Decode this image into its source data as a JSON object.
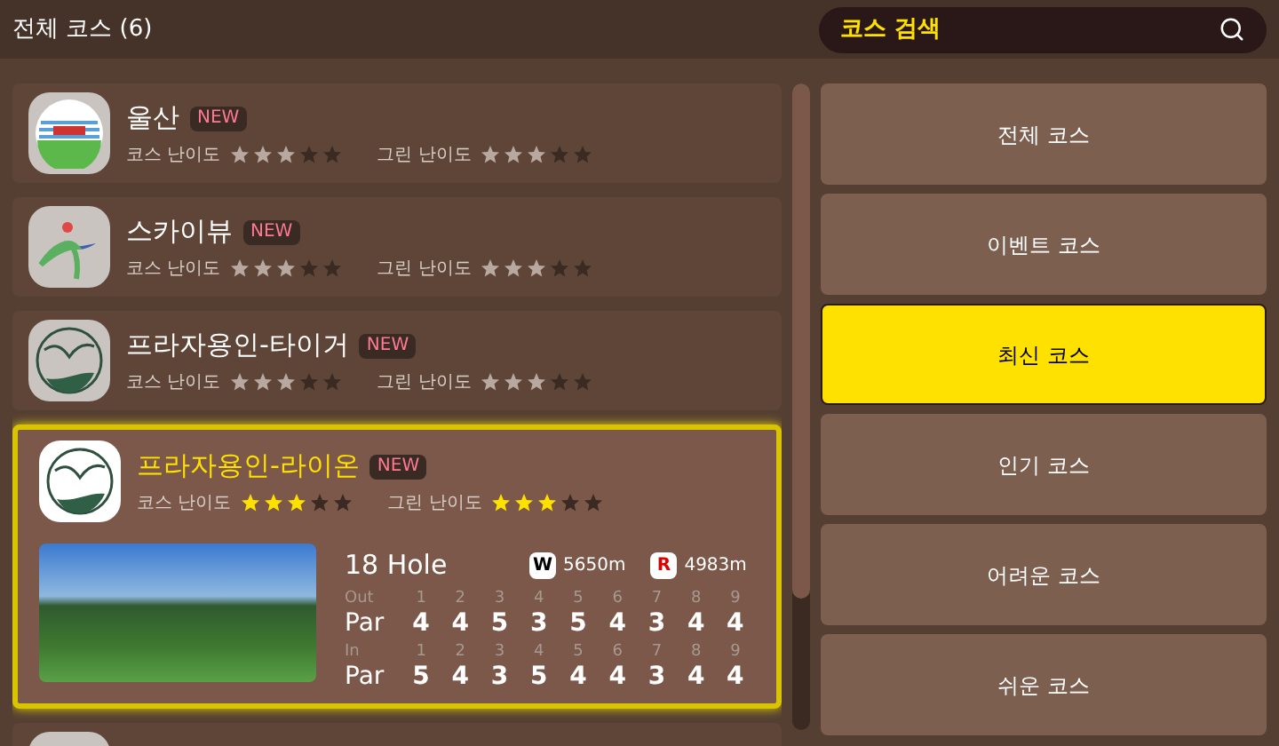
{
  "header": {
    "title": "전체 코스 (6)"
  },
  "search": {
    "placeholder": "코스 검색"
  },
  "courses": [
    {
      "name": "울산",
      "badge": "NEW",
      "kind": "ulsan",
      "selected": false,
      "ratings": [
        {
          "label": "코스 난이도",
          "stars": 3
        },
        {
          "label": "그린 난이도",
          "stars": 3
        }
      ]
    },
    {
      "name": "스카이뷰",
      "badge": "NEW",
      "kind": "skyview",
      "selected": false,
      "ratings": [
        {
          "label": "코스 난이도",
          "stars": 3
        },
        {
          "label": "그린 난이도",
          "stars": 3
        }
      ]
    },
    {
      "name": "프라자용인-타이거",
      "badge": "NEW",
      "kind": "plaza",
      "selected": false,
      "ratings": [
        {
          "label": "코스 난이도",
          "stars": 3
        },
        {
          "label": "그린 난이도",
          "stars": 3
        }
      ]
    },
    {
      "name": "프라자용인-라이온",
      "badge": "NEW",
      "kind": "plaza",
      "selected": true,
      "ratings": [
        {
          "label": "코스 난이도",
          "stars": 3
        },
        {
          "label": "그린 난이도",
          "stars": 3
        }
      ],
      "details": {
        "holes": "18 Hole",
        "white_tee": {
          "mark": "W",
          "distance": "5650m"
        },
        "red_tee": {
          "mark": "R",
          "distance": "4983m"
        },
        "halves": [
          {
            "label": "Out",
            "numbers": [
              "1",
              "2",
              "3",
              "4",
              "5",
              "6",
              "7",
              "8",
              "9"
            ],
            "row_label": "Par",
            "pars": [
              "4",
              "4",
              "5",
              "3",
              "5",
              "4",
              "3",
              "4",
              "4"
            ]
          },
          {
            "label": "In",
            "numbers": [
              "1",
              "2",
              "3",
              "4",
              "5",
              "6",
              "7",
              "8",
              "9"
            ],
            "row_label": "Par",
            "pars": [
              "5",
              "4",
              "3",
              "5",
              "4",
              "4",
              "3",
              "4",
              "4"
            ]
          }
        ]
      }
    }
  ],
  "filters": [
    {
      "label": "전체 코스",
      "selected": false
    },
    {
      "label": "이벤트 코스",
      "selected": false
    },
    {
      "label": "최신 코스",
      "selected": true
    },
    {
      "label": "인기 코스",
      "selected": false
    },
    {
      "label": "어려운 코스",
      "selected": false
    },
    {
      "label": "쉬운 코스",
      "selected": false
    }
  ]
}
